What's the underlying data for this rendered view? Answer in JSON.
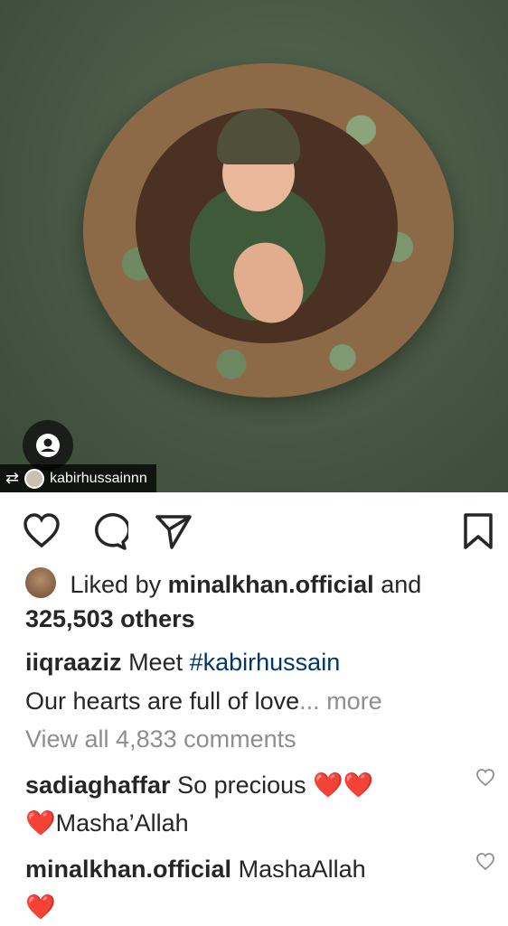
{
  "post": {
    "repost_username": "kabirhussainnn"
  },
  "likes": {
    "prefix": "Liked by",
    "liker": "minalkhan.official",
    "conjunction": "and",
    "others": "325,503 others"
  },
  "caption": {
    "username": "iiqraaziz",
    "text1": "Meet",
    "hashtag": "#kabirhussain",
    "line2": "Our hearts are full of love",
    "ellipsis": "...",
    "more": "more"
  },
  "comments_link": "View all 4,833 comments",
  "comments": [
    {
      "username": "sadiaghaffar",
      "text": "So precious",
      "emoji": "❤️❤️",
      "line2_emoji": "❤️",
      "line2_text": "Masha’Allah"
    },
    {
      "username": "minalkhan.official",
      "text": "MashaAllah",
      "line2_emoji": "❤️"
    }
  ],
  "colors": {
    "accent_link": "#00376b",
    "muted": "#8e8e8e",
    "heart": "#e0245e"
  }
}
